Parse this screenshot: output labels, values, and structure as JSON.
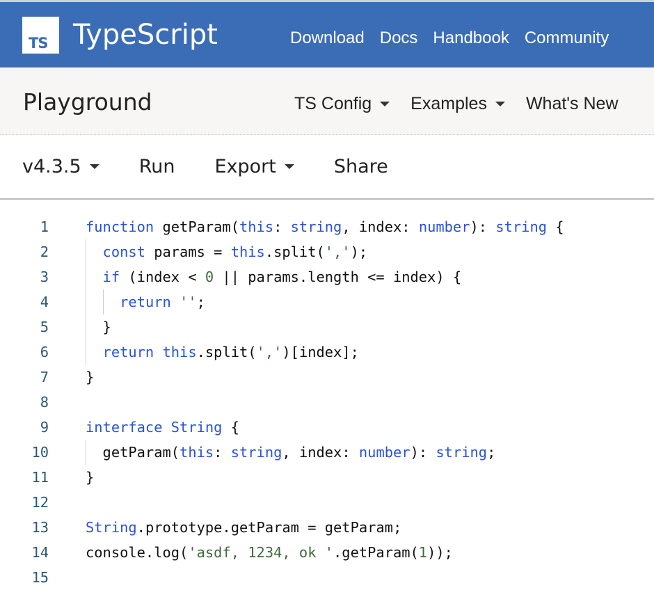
{
  "header": {
    "logo_text": "TS",
    "brand": "TypeScript",
    "nav": [
      "Download",
      "Docs",
      "Handbook",
      "Community"
    ]
  },
  "subnav": {
    "title": "Playground",
    "menus": [
      "TS Config",
      "Examples",
      "What's New"
    ]
  },
  "toolbar": {
    "version": "v4.3.5",
    "run": "Run",
    "export": "Export",
    "share": "Share"
  },
  "colors": {
    "brand": "#3b6db7",
    "keyword": "#2a52d8",
    "string": "#3f6b3a",
    "line_number": "#2b5878"
  },
  "editor": {
    "lines": [
      {
        "n": "1",
        "indent": 0,
        "tokens": [
          [
            "function",
            "kw"
          ],
          [
            " getParam(",
            ""
          ],
          [
            "this",
            "kw"
          ],
          [
            ": ",
            ""
          ],
          [
            "string",
            "kw"
          ],
          [
            ", index: ",
            ""
          ],
          [
            "number",
            "kw"
          ],
          [
            "): ",
            ""
          ],
          [
            "string",
            "kw"
          ],
          [
            " {",
            ""
          ]
        ]
      },
      {
        "n": "2",
        "indent": 1,
        "tokens": [
          [
            "const",
            "kw"
          ],
          [
            " params = ",
            ""
          ],
          [
            "this",
            "kw"
          ],
          [
            ".split(",
            ""
          ],
          [
            "','",
            "str"
          ],
          [
            ");",
            ""
          ]
        ]
      },
      {
        "n": "3",
        "indent": 1,
        "tokens": [
          [
            "if",
            "kw"
          ],
          [
            " (index < ",
            ""
          ],
          [
            "0",
            "num"
          ],
          [
            " || params.length <= index) {",
            ""
          ]
        ]
      },
      {
        "n": "4",
        "indent": 2,
        "tokens": [
          [
            "return",
            "kw"
          ],
          [
            " ",
            ""
          ],
          [
            "''",
            "str"
          ],
          [
            ";",
            ""
          ]
        ]
      },
      {
        "n": "5",
        "indent": 1,
        "tokens": [
          [
            "}",
            ""
          ]
        ]
      },
      {
        "n": "6",
        "indent": 1,
        "tokens": [
          [
            "return",
            "kw"
          ],
          [
            " ",
            ""
          ],
          [
            "this",
            "kw"
          ],
          [
            ".split(",
            ""
          ],
          [
            "','",
            "str"
          ],
          [
            ")[index];",
            ""
          ]
        ]
      },
      {
        "n": "7",
        "indent": 0,
        "tokens": [
          [
            "}",
            ""
          ]
        ]
      },
      {
        "n": "8",
        "indent": 0,
        "tokens": []
      },
      {
        "n": "9",
        "indent": 0,
        "tokens": [
          [
            "interface",
            "kw"
          ],
          [
            " ",
            ""
          ],
          [
            "String",
            "kw"
          ],
          [
            " {",
            ""
          ]
        ]
      },
      {
        "n": "10",
        "indent": 1,
        "tokens": [
          [
            "getParam(",
            ""
          ],
          [
            "this",
            "kw"
          ],
          [
            ": ",
            ""
          ],
          [
            "string",
            "kw"
          ],
          [
            ", index: ",
            ""
          ],
          [
            "number",
            "kw"
          ],
          [
            "): ",
            ""
          ],
          [
            "string",
            "kw"
          ],
          [
            ";",
            ""
          ]
        ]
      },
      {
        "n": "11",
        "indent": 0,
        "tokens": [
          [
            "}",
            ""
          ]
        ]
      },
      {
        "n": "12",
        "indent": 0,
        "tokens": []
      },
      {
        "n": "13",
        "indent": 0,
        "tokens": [
          [
            "String",
            "kw"
          ],
          [
            ".prototype.getParam = getParam;",
            ""
          ]
        ]
      },
      {
        "n": "14",
        "indent": 0,
        "tokens": [
          [
            "console.log(",
            ""
          ],
          [
            "'asdf, 1234, ok '",
            "str"
          ],
          [
            ".getParam(",
            ""
          ],
          [
            "1",
            "num"
          ],
          [
            "));",
            ""
          ]
        ]
      },
      {
        "n": "15",
        "indent": 0,
        "tokens": []
      }
    ]
  }
}
